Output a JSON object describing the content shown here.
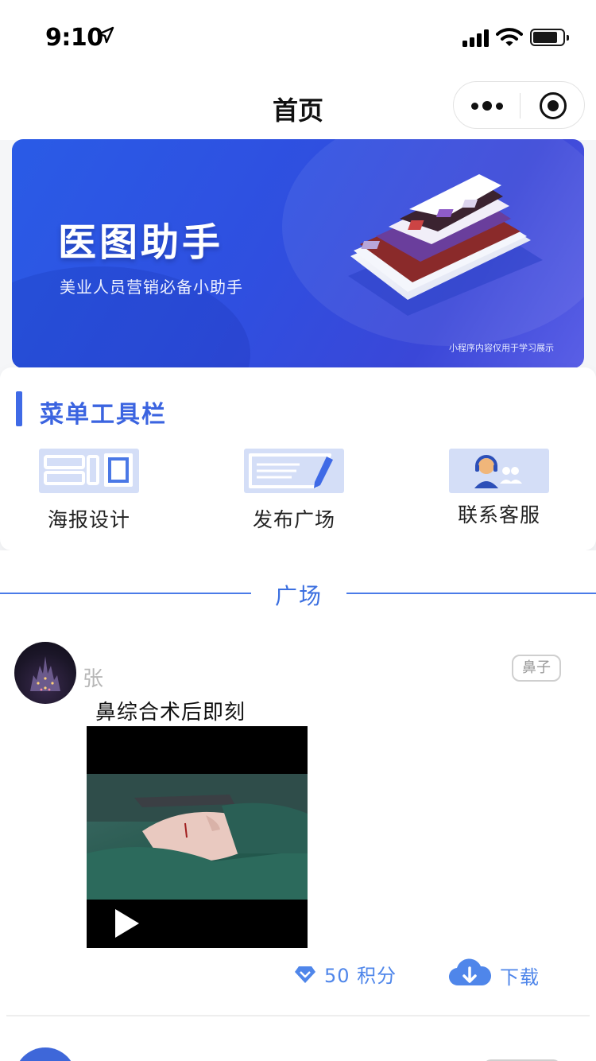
{
  "status_bar": {
    "time": "9:10"
  },
  "nav": {
    "title": "首页"
  },
  "banner": {
    "title": "医图助手",
    "subtitle": "美业人员营销必备小助手",
    "note": "小程序内容仅用于学习展示",
    "colors": {
      "from": "#2a5be6",
      "to": "#5a5fe6"
    }
  },
  "menu": {
    "title": "菜单工具栏",
    "items": [
      {
        "label": "海报设计",
        "icon": "poster-layout-icon"
      },
      {
        "label": "发布广场",
        "icon": "edit-pencil-icon"
      },
      {
        "label": "联系客服",
        "icon": "customer-service-icon"
      }
    ]
  },
  "section": {
    "title": "广场"
  },
  "posts": [
    {
      "author": "张",
      "tag": "鼻子",
      "text": "鼻综合术后即刻",
      "points": "50 积分",
      "download_label": "下载"
    }
  ],
  "colors": {
    "accent": "#3b64e0",
    "link": "#4f86ea",
    "tile_bg": "#d4def7"
  }
}
